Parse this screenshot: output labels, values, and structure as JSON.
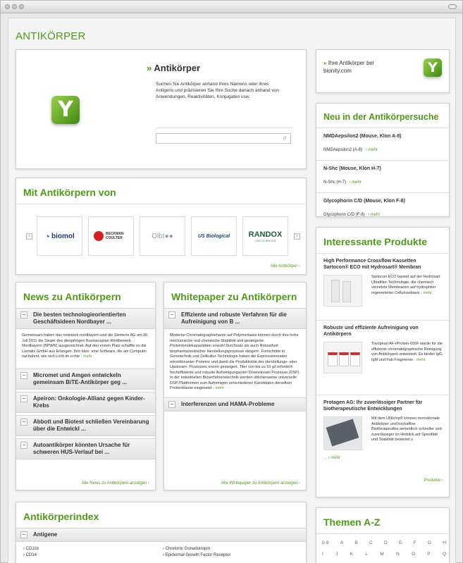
{
  "page_title": "ANTIKÖRPER",
  "hero": {
    "title": "Antikörper",
    "description": "Suchen Sie Antikörper anhand ihres Namens oder ihres Antigens und präzisieren Sie Ihre Suche danach anhand von Anwendungen, Reaktivitäten, Konjugaten usw.",
    "search_placeholder": ""
  },
  "bionity": {
    "text": "Ihre Antikörper bei bionity.com"
  },
  "mit": {
    "title": "Mit Antikörpern von",
    "brands": [
      "biomol",
      "BECKMAN COULTER",
      "Olbt●●",
      "US Biological",
      "RANDOX"
    ],
    "brand_subs": [
      "",
      "",
      "",
      "",
      "LIFE SCIENCES"
    ],
    "all_link": "Alle Antikörper ›"
  },
  "neu": {
    "title": "Neu in der Antikörpersuche",
    "items": [
      {
        "title": "NMDAepsilon2 (Mouse, Klon A-8)",
        "sub": "NMDAepsilon2 (A-8)",
        "more": "› mehr"
      },
      {
        "title": "N-Shc (Mouse, Klon H-7)",
        "sub": "N-Shc (H-7)",
        "more": "› mehr"
      },
      {
        "title": "Glycophorin C/D (Mouse, Klon F-8)",
        "sub": "Glycophorin C/D (F-8)",
        "more": "› mehr"
      }
    ]
  },
  "produkte": {
    "title": "Interessante Produkte",
    "items": [
      {
        "title": "High Performance Crossflow Kassetten Sartocon® ECO mit Hydrosart® Membran",
        "text": "Sartocon ECO basiert auf der Hydrosart Ultrafilter-Technologie, die chemisch vernetzte Membranen auf hydrophiler regenerierter Cellulosebasis",
        "more": "› mehr"
      },
      {
        "title": "Robuste und effiziente Aufreinigung von Antikörpern",
        "text": "Toyopearl AF-rProtein-650F wurde für die effiziente chromatographische Reinigung von Antikörpern entwickelt. Es bindet IgG, IgM und Fab Fragmente",
        "more": "› mehr"
      },
      {
        "title": "Protagen AG: Ihr zuverlässiger Partner für biotherapeutische Entwicklungen",
        "text": "Mit dem UNIchip® können monoklonale Antikörper und hochaffine Biotherapeutika wesentlich schneller und zuverlässiger im Hinblick auf Spezifität und Stabilität bewertet u",
        "more": "... › mehr"
      }
    ],
    "all_link": "Produkte ›"
  },
  "news": {
    "title": "News zu Antikörpern",
    "items": [
      "Die besten technologieorientierten Geschäftsideen Nordbayer ...",
      "Micromet und Amgen entwickeln gemeinsam BiTE-Antikörper geg ...",
      "Apeiron: Onkologie-Allianz gegen Kinder-Krebs",
      "Abbott und Biotest schließen Vereinbarung über die Entwickl ...",
      "Autoantikörper könnten Ursache für schweren HUS-Verlauf bei ..."
    ],
    "body": "Gemeinsam haben das netzwerk nordbayern und die Siemens AG am 20. Juli 2011 die Sieger des diesjährigen Businessplan-Wettbewerb Nordbayern (BPWN) ausgezeichnet. Auf den ersten Platz schaffte es die Lumatix GmbH aus Erlangen. Ihre Idee: eine Software, die am Computer nachahmt, wie sich Licht im echte",
    "more": "› mehr",
    "all_link": "Alle News zu Antikörpern anzeigen ›"
  },
  "whitepaper": {
    "title": "Whitepaper zu Antikörpern",
    "items": [
      "Effiziente und robuste Verfahren für die Aufreinigung von B ...",
      "Interferenzen und HAMA-Probleme"
    ],
    "body": "Moderne Chromatographieharze auf Polymerbasis können durch ihre hohe mechanische und chemische Stabilität und gesteigerte Proteinbindekapazitäten sowohl Durchsatz als auch Robustheit biopharmazeutischer Herstellungsprozesse steigern. Fortschritte in Genetechnik und Zellkultur-Technologie haben die Expressionsraten rekombinanter Proteine und damit die Produktivität des Herstellungs- oder Upstream- Prozesses enorm gesteigert. Titer von bis zu 10 g/l erfordern hochoffiziente und robuste Aufreinigungsoder Downstream Prozesse (DSP). In der industriellen Bioverfahrenstechnik werden üblicherweise universelle DSP-Plattformen zum Aufreinigen verschiedener Kandidaten derselben Proteinklasse eingesetzt",
    "more": "› mehr",
    "all_link": "Alle Whitepaper zu Antikörpern anzeigen ›"
  },
  "index": {
    "title": "Antikörperindex",
    "section": "Antigene",
    "col1": [
      "› CD11b",
      "› CD14"
    ],
    "col2": [
      "› Chorionic Gonadotropin",
      "› Epidermal Growth Factor Receptor"
    ]
  },
  "themen": {
    "title": "Themen A-Z",
    "row1": [
      "0-9",
      "A",
      "B",
      "C",
      "D",
      "E",
      "F",
      "G",
      "H"
    ],
    "row2": [
      "I",
      "J",
      "K",
      "L",
      "M",
      "N",
      "O",
      "P",
      "Q"
    ]
  },
  "colors": {
    "accent": "#4e9a17"
  }
}
